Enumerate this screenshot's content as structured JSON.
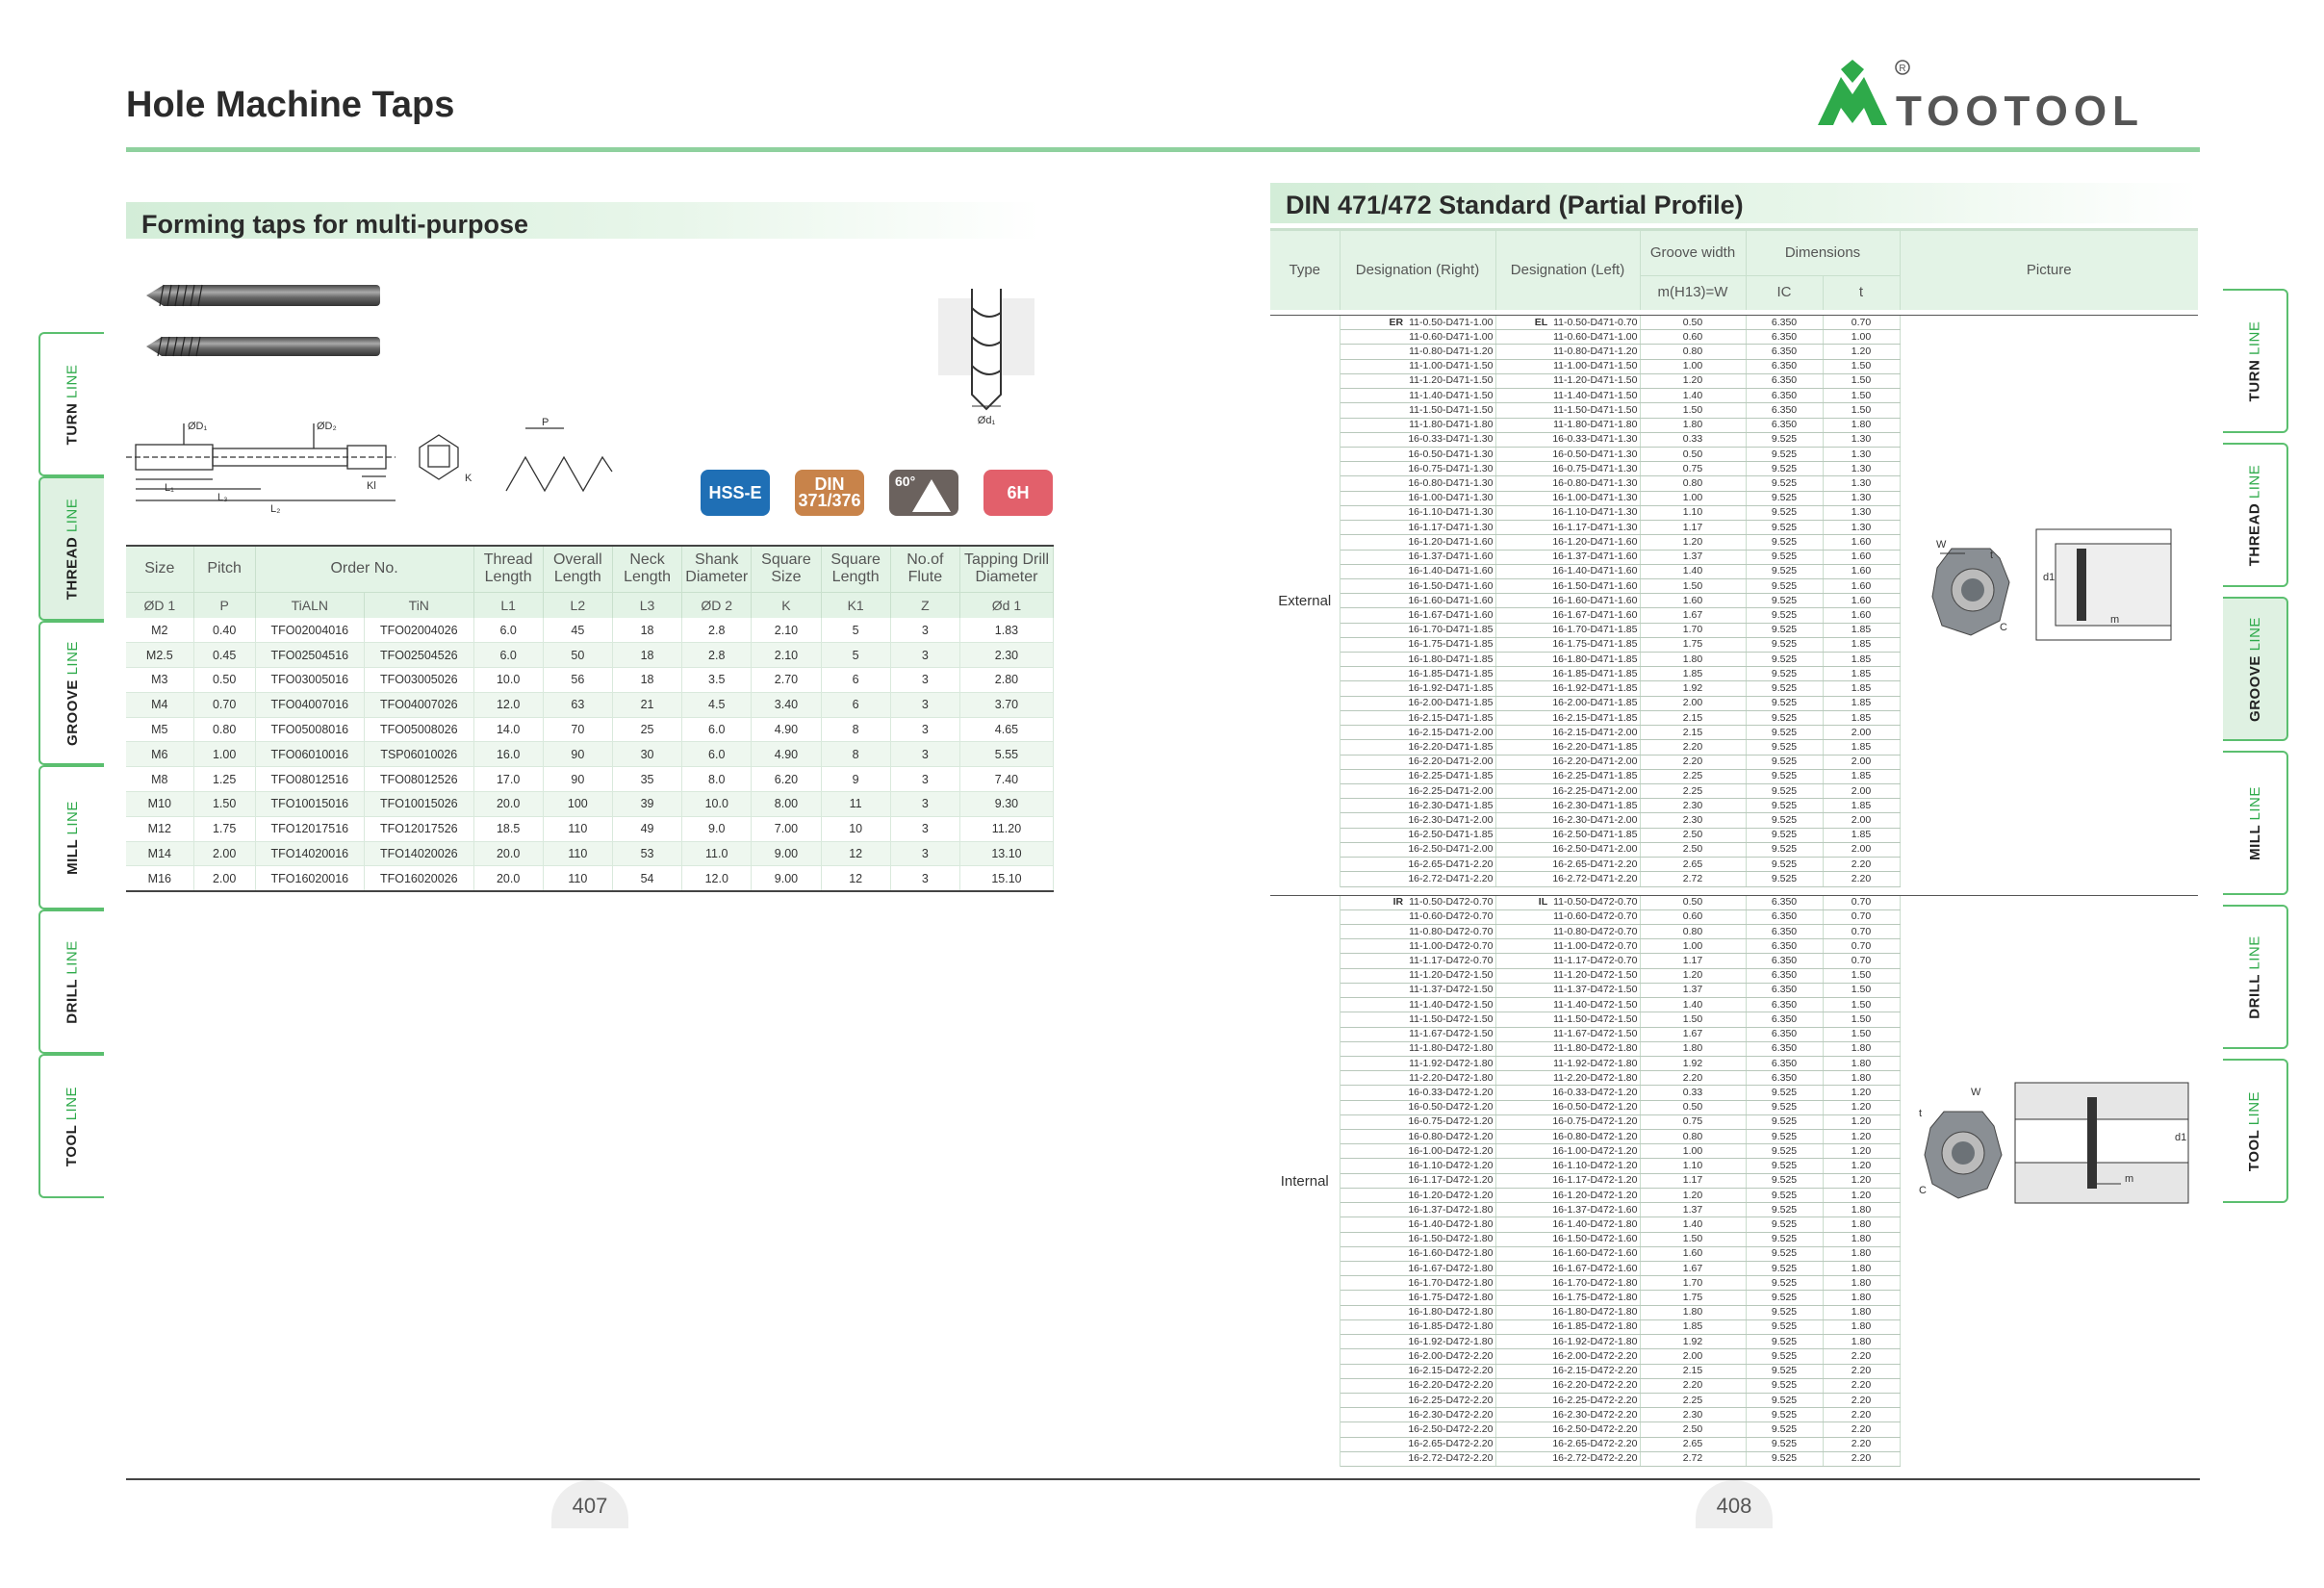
{
  "page_title": "Hole Machine Taps",
  "logo_text": "TOOTOOL",
  "left_section_title": "Forming taps for multi-purpose",
  "right_section_title": "DIN 471/472 Standard (Partial Profile)",
  "left_tabs": [
    {
      "label_a": "TURN ",
      "label_b": "LINE",
      "active": false
    },
    {
      "label_a": "THREAD ",
      "label_b": "LINE",
      "active": true
    },
    {
      "label_a": "GROOVE ",
      "label_b": "LINE",
      "active": false
    },
    {
      "label_a": "MILL ",
      "label_b": "LINE",
      "active": false
    },
    {
      "label_a": "DRILL ",
      "label_b": "LINE",
      "active": false
    },
    {
      "label_a": "TOOL ",
      "label_b": "LINE",
      "active": false
    }
  ],
  "right_tabs": [
    {
      "label_a": "TURN ",
      "label_b": "LINE",
      "active": false
    },
    {
      "label_a": "THREAD ",
      "label_b": "LINE",
      "active": false
    },
    {
      "label_a": "GROOVE ",
      "label_b": "LINE",
      "active": true
    },
    {
      "label_a": "MILL ",
      "label_b": "LINE",
      "active": false
    },
    {
      "label_a": "DRILL ",
      "label_b": "LINE",
      "active": false
    },
    {
      "label_a": "TOOL ",
      "label_b": "LINE",
      "active": false
    }
  ],
  "diagram_labels": {
    "d1": "ØD₁",
    "d2": "ØD₂",
    "l1": "L₁",
    "l2": "L₂",
    "l3": "L₃",
    "kl": "Kl",
    "k": "K",
    "p": "P",
    "drill_d1": "Ød₁"
  },
  "badges": [
    {
      "text": "HSS-E",
      "color": "#1f6fb5"
    },
    {
      "text": "DIN\n371/376",
      "color": "#c8834a"
    },
    {
      "text": "60°",
      "color": "#6b625e"
    },
    {
      "text": "6H",
      "color": "#e2606b"
    }
  ],
  "taps_table": {
    "header1": [
      "Size",
      "Pitch",
      "Order No.",
      "Thread Length",
      "Overall Length",
      "Neck Length",
      "Shank Diameter",
      "Square Size",
      "Square Length",
      "No.of Flute",
      "Tapping Drill Diameter"
    ],
    "header2": [
      "ØD 1",
      "P",
      "TiALN",
      "TiN",
      "L1",
      "L2",
      "L3",
      "ØD 2",
      "K",
      "K1",
      "Z",
      "Ød 1"
    ],
    "rows": [
      [
        "M2",
        "0.40",
        "TFO02004016",
        "TFO02004026",
        "6.0",
        "45",
        "18",
        "2.8",
        "2.10",
        "5",
        "3",
        "1.83"
      ],
      [
        "M2.5",
        "0.45",
        "TFO02504516",
        "TFO02504526",
        "6.0",
        "50",
        "18",
        "2.8",
        "2.10",
        "5",
        "3",
        "2.30"
      ],
      [
        "M3",
        "0.50",
        "TFO03005016",
        "TFO03005026",
        "10.0",
        "56",
        "18",
        "3.5",
        "2.70",
        "6",
        "3",
        "2.80"
      ],
      [
        "M4",
        "0.70",
        "TFO04007016",
        "TFO04007026",
        "12.0",
        "63",
        "21",
        "4.5",
        "3.40",
        "6",
        "3",
        "3.70"
      ],
      [
        "M5",
        "0.80",
        "TFO05008016",
        "TFO05008026",
        "14.0",
        "70",
        "25",
        "6.0",
        "4.90",
        "8",
        "3",
        "4.65"
      ],
      [
        "M6",
        "1.00",
        "TFO06010016",
        "TSP06010026",
        "16.0",
        "90",
        "30",
        "6.0",
        "4.90",
        "8",
        "3",
        "5.55"
      ],
      [
        "M8",
        "1.25",
        "TFO08012516",
        "TFO08012526",
        "17.0",
        "90",
        "35",
        "8.0",
        "6.20",
        "9",
        "3",
        "7.40"
      ],
      [
        "M10",
        "1.50",
        "TFO10015016",
        "TFO10015026",
        "20.0",
        "100",
        "39",
        "10.0",
        "8.00",
        "11",
        "3",
        "9.30"
      ],
      [
        "M12",
        "1.75",
        "TFO12017516",
        "TFO12017526",
        "18.5",
        "110",
        "49",
        "9.0",
        "7.00",
        "10",
        "3",
        "11.20"
      ],
      [
        "M14",
        "2.00",
        "TFO14020016",
        "TFO14020026",
        "20.0",
        "110",
        "53",
        "11.0",
        "9.00",
        "12",
        "3",
        "13.10"
      ],
      [
        "M16",
        "2.00",
        "TFO16020016",
        "TFO16020026",
        "20.0",
        "110",
        "54",
        "12.0",
        "9.00",
        "12",
        "3",
        "15.10"
      ]
    ]
  },
  "din_table": {
    "headers": {
      "type": "Type",
      "des_right": "Designation (Right)",
      "des_left": "Designation (Left)",
      "groove": "Groove width",
      "groove_sub": "m(H13)=W",
      "dims": "Dimensions",
      "ic": "IC",
      "t": "t",
      "picture": "Picture"
    },
    "external": {
      "type": "External",
      "prefix_r": "ER",
      "prefix_l": "EL",
      "rows": [
        [
          "11-0.50-D471-1.00",
          "11-0.50-D471-0.70",
          "0.50",
          "6.350",
          "0.70"
        ],
        [
          "11-0.60-D471-1.00",
          "11-0.60-D471-1.00",
          "0.60",
          "6.350",
          "1.00"
        ],
        [
          "11-0.80-D471-1.20",
          "11-0.80-D471-1.20",
          "0.80",
          "6.350",
          "1.20"
        ],
        [
          "11-1.00-D471-1.50",
          "11-1.00-D471-1.50",
          "1.00",
          "6.350",
          "1.50"
        ],
        [
          "11-1.20-D471-1.50",
          "11-1.20-D471-1.50",
          "1.20",
          "6.350",
          "1.50"
        ],
        [
          "11-1.40-D471-1.50",
          "11-1.40-D471-1.50",
          "1.40",
          "6.350",
          "1.50"
        ],
        [
          "11-1.50-D471-1.50",
          "11-1.50-D471-1.50",
          "1.50",
          "6.350",
          "1.50"
        ],
        [
          "11-1.80-D471-1.80",
          "11-1.80-D471-1.80",
          "1.80",
          "6.350",
          "1.80"
        ],
        [
          "16-0.33-D471-1.30",
          "16-0.33-D471-1.30",
          "0.33",
          "9.525",
          "1.30"
        ],
        [
          "16-0.50-D471-1.30",
          "16-0.50-D471-1.30",
          "0.50",
          "9.525",
          "1.30"
        ],
        [
          "16-0.75-D471-1.30",
          "16-0.75-D471-1.30",
          "0.75",
          "9.525",
          "1.30"
        ],
        [
          "16-0.80-D471-1.30",
          "16-0.80-D471-1.30",
          "0.80",
          "9.525",
          "1.30"
        ],
        [
          "16-1.00-D471-1.30",
          "16-1.00-D471-1.30",
          "1.00",
          "9.525",
          "1.30"
        ],
        [
          "16-1.10-D471-1.30",
          "16-1.10-D471-1.30",
          "1.10",
          "9.525",
          "1.30"
        ],
        [
          "16-1.17-D471-1.30",
          "16-1.17-D471-1.30",
          "1.17",
          "9.525",
          "1.30"
        ],
        [
          "16-1.20-D471-1.60",
          "16-1.20-D471-1.60",
          "1.20",
          "9.525",
          "1.60"
        ],
        [
          "16-1.37-D471-1.60",
          "16-1.37-D471-1.60",
          "1.37",
          "9.525",
          "1.60"
        ],
        [
          "16-1.40-D471-1.60",
          "16-1.40-D471-1.60",
          "1.40",
          "9.525",
          "1.60"
        ],
        [
          "16-1.50-D471-1.60",
          "16-1.50-D471-1.60",
          "1.50",
          "9.525",
          "1.60"
        ],
        [
          "16-1.60-D471-1.60",
          "16-1.60-D471-1.60",
          "1.60",
          "9.525",
          "1.60"
        ],
        [
          "16-1.67-D471-1.60",
          "16-1.67-D471-1.60",
          "1.67",
          "9.525",
          "1.60"
        ],
        [
          "16-1.70-D471-1.85",
          "16-1.70-D471-1.85",
          "1.70",
          "9.525",
          "1.85"
        ],
        [
          "16-1.75-D471-1.85",
          "16-1.75-D471-1.85",
          "1.75",
          "9.525",
          "1.85"
        ],
        [
          "16-1.80-D471-1.85",
          "16-1.80-D471-1.85",
          "1.80",
          "9.525",
          "1.85"
        ],
        [
          "16-1.85-D471-1.85",
          "16-1.85-D471-1.85",
          "1.85",
          "9.525",
          "1.85"
        ],
        [
          "16-1.92-D471-1.85",
          "16-1.92-D471-1.85",
          "1.92",
          "9.525",
          "1.85"
        ],
        [
          "16-2.00-D471-1.85",
          "16-2.00-D471-1.85",
          "2.00",
          "9.525",
          "1.85"
        ],
        [
          "16-2.15-D471-1.85",
          "16-2.15-D471-1.85",
          "2.15",
          "9.525",
          "1.85"
        ],
        [
          "16-2.15-D471-2.00",
          "16-2.15-D471-2.00",
          "2.15",
          "9.525",
          "2.00"
        ],
        [
          "16-2.20-D471-1.85",
          "16-2.20-D471-1.85",
          "2.20",
          "9.525",
          "1.85"
        ],
        [
          "16-2.20-D471-2.00",
          "16-2.20-D471-2.00",
          "2.20",
          "9.525",
          "2.00"
        ],
        [
          "16-2.25-D471-1.85",
          "16-2.25-D471-1.85",
          "2.25",
          "9.525",
          "1.85"
        ],
        [
          "16-2.25-D471-2.00",
          "16-2.25-D471-2.00",
          "2.25",
          "9.525",
          "2.00"
        ],
        [
          "16-2.30-D471-1.85",
          "16-2.30-D471-1.85",
          "2.30",
          "9.525",
          "1.85"
        ],
        [
          "16-2.30-D471-2.00",
          "16-2.30-D471-2.00",
          "2.30",
          "9.525",
          "2.00"
        ],
        [
          "16-2.50-D471-1.85",
          "16-2.50-D471-1.85",
          "2.50",
          "9.525",
          "1.85"
        ],
        [
          "16-2.50-D471-2.00",
          "16-2.50-D471-2.00",
          "2.50",
          "9.525",
          "2.00"
        ],
        [
          "16-2.65-D471-2.20",
          "16-2.65-D471-2.20",
          "2.65",
          "9.525",
          "2.20"
        ],
        [
          "16-2.72-D471-2.20",
          "16-2.72-D471-2.20",
          "2.72",
          "9.525",
          "2.20"
        ]
      ]
    },
    "internal": {
      "type": "Internal",
      "prefix_r": "IR",
      "prefix_l": "IL",
      "rows": [
        [
          "11-0.50-D472-0.70",
          "11-0.50-D472-0.70",
          "0.50",
          "6.350",
          "0.70"
        ],
        [
          "11-0.60-D472-0.70",
          "11-0.60-D472-0.70",
          "0.60",
          "6.350",
          "0.70"
        ],
        [
          "11-0.80-D472-0.70",
          "11-0.80-D472-0.70",
          "0.80",
          "6.350",
          "0.70"
        ],
        [
          "11-1.00-D472-0.70",
          "11-1.00-D472-0.70",
          "1.00",
          "6.350",
          "0.70"
        ],
        [
          "11-1.17-D472-0.70",
          "11-1.17-D472-0.70",
          "1.17",
          "6.350",
          "0.70"
        ],
        [
          "11-1.20-D472-1.50",
          "11-1.20-D472-1.50",
          "1.20",
          "6.350",
          "1.50"
        ],
        [
          "11-1.37-D472-1.50",
          "11-1.37-D472-1.50",
          "1.37",
          "6.350",
          "1.50"
        ],
        [
          "11-1.40-D472-1.50",
          "11-1.40-D472-1.50",
          "1.40",
          "6.350",
          "1.50"
        ],
        [
          "11-1.50-D472-1.50",
          "11-1.50-D472-1.50",
          "1.50",
          "6.350",
          "1.50"
        ],
        [
          "11-1.67-D472-1.50",
          "11-1.67-D472-1.50",
          "1.67",
          "6.350",
          "1.50"
        ],
        [
          "11-1.80-D472-1.80",
          "11-1.80-D472-1.80",
          "1.80",
          "6.350",
          "1.80"
        ],
        [
          "11-1.92-D472-1.80",
          "11-1.92-D472-1.80",
          "1.92",
          "6.350",
          "1.80"
        ],
        [
          "11-2.20-D472-1.80",
          "11-2.20-D472-1.80",
          "2.20",
          "6.350",
          "1.80"
        ],
        [
          "16-0.33-D472-1.20",
          "16-0.33-D472-1.20",
          "0.33",
          "9.525",
          "1.20"
        ],
        [
          "16-0.50-D472-1.20",
          "16-0.50-D472-1.20",
          "0.50",
          "9.525",
          "1.20"
        ],
        [
          "16-0.75-D472-1.20",
          "16-0.75-D472-1.20",
          "0.75",
          "9.525",
          "1.20"
        ],
        [
          "16-0.80-D472-1.20",
          "16-0.80-D472-1.20",
          "0.80",
          "9.525",
          "1.20"
        ],
        [
          "16-1.00-D472-1.20",
          "16-1.00-D472-1.20",
          "1.00",
          "9.525",
          "1.20"
        ],
        [
          "16-1.10-D472-1.20",
          "16-1.10-D472-1.20",
          "1.10",
          "9.525",
          "1.20"
        ],
        [
          "16-1.17-D472-1.20",
          "16-1.17-D472-1.20",
          "1.17",
          "9.525",
          "1.20"
        ],
        [
          "16-1.20-D472-1.20",
          "16-1.20-D472-1.20",
          "1.20",
          "9.525",
          "1.20"
        ],
        [
          "16-1.37-D472-1.80",
          "16-1.37-D472-1.60",
          "1.37",
          "9.525",
          "1.80"
        ],
        [
          "16-1.40-D472-1.80",
          "16-1.40-D472-1.80",
          "1.40",
          "9.525",
          "1.80"
        ],
        [
          "16-1.50-D472-1.80",
          "16-1.50-D472-1.60",
          "1.50",
          "9.525",
          "1.80"
        ],
        [
          "16-1.60-D472-1.80",
          "16-1.60-D472-1.60",
          "1.60",
          "9.525",
          "1.80"
        ],
        [
          "16-1.67-D472-1.80",
          "16-1.67-D472-1.60",
          "1.67",
          "9.525",
          "1.80"
        ],
        [
          "16-1.70-D472-1.80",
          "16-1.70-D472-1.80",
          "1.70",
          "9.525",
          "1.80"
        ],
        [
          "16-1.75-D472-1.80",
          "16-1.75-D472-1.80",
          "1.75",
          "9.525",
          "1.80"
        ],
        [
          "16-1.80-D472-1.80",
          "16-1.80-D472-1.80",
          "1.80",
          "9.525",
          "1.80"
        ],
        [
          "16-1.85-D472-1.80",
          "16-1.85-D472-1.80",
          "1.85",
          "9.525",
          "1.80"
        ],
        [
          "16-1.92-D472-1.80",
          "16-1.92-D472-1.80",
          "1.92",
          "9.525",
          "1.80"
        ],
        [
          "16-2.00-D472-2.20",
          "16-2.00-D472-2.20",
          "2.00",
          "9.525",
          "2.20"
        ],
        [
          "16-2.15-D472-2.20",
          "16-2.15-D472-2.20",
          "2.15",
          "9.525",
          "2.20"
        ],
        [
          "16-2.20-D472-2.20",
          "16-2.20-D472-2.20",
          "2.20",
          "9.525",
          "2.20"
        ],
        [
          "16-2.25-D472-2.20",
          "16-2.25-D472-2.20",
          "2.25",
          "9.525",
          "2.20"
        ],
        [
          "16-2.30-D472-2.20",
          "16-2.30-D472-2.20",
          "2.30",
          "9.525",
          "2.20"
        ],
        [
          "16-2.50-D472-2.20",
          "16-2.50-D472-2.20",
          "2.50",
          "9.525",
          "2.20"
        ],
        [
          "16-2.65-D472-2.20",
          "16-2.65-D472-2.20",
          "2.65",
          "9.525",
          "2.20"
        ],
        [
          "16-2.72-D472-2.20",
          "16-2.72-D472-2.20",
          "2.72",
          "9.525",
          "2.20"
        ]
      ]
    }
  },
  "picture_labels": {
    "w": "W",
    "t": "t",
    "c": "C",
    "d1": "d1",
    "m": "m"
  },
  "page_numbers": {
    "left": "407",
    "right": "408"
  }
}
